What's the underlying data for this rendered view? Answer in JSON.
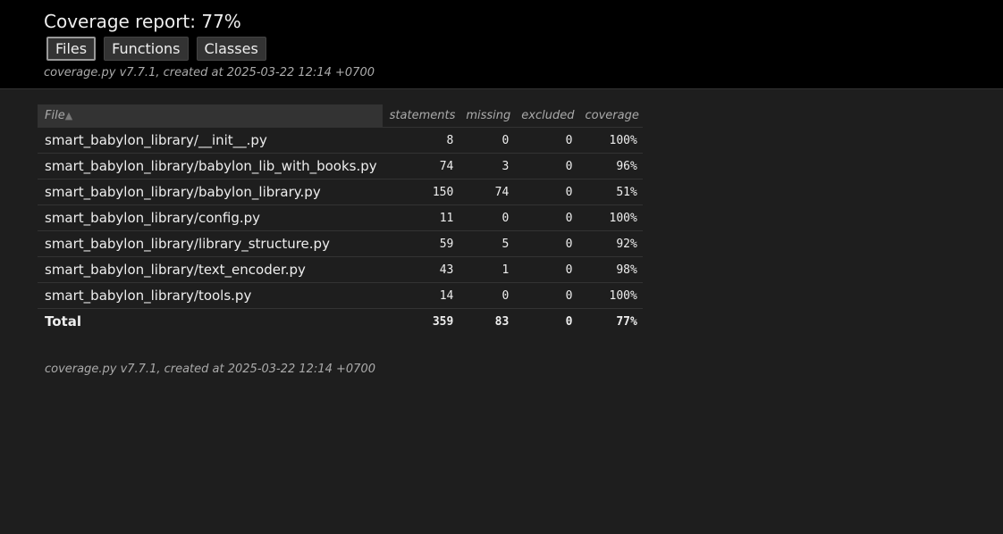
{
  "header": {
    "title": "Coverage report: 77%",
    "tabs": [
      {
        "label": "Files",
        "current": true
      },
      {
        "label": "Functions",
        "current": false
      },
      {
        "label": "Classes",
        "current": false
      }
    ],
    "meta": "coverage.py v7.7.1, created at 2025-03-22 12:14 +0700"
  },
  "table": {
    "columns": {
      "file": "File",
      "sort_indicator": "▲",
      "statements": "statements",
      "missing": "missing",
      "excluded": "excluded",
      "coverage": "coverage"
    },
    "rows": [
      {
        "file": "smart_babylon_library/__init__.py",
        "statements": "8",
        "missing": "0",
        "excluded": "0",
        "coverage": "100%"
      },
      {
        "file": "smart_babylon_library/babylon_lib_with_books.py",
        "statements": "74",
        "missing": "3",
        "excluded": "0",
        "coverage": "96%"
      },
      {
        "file": "smart_babylon_library/babylon_library.py",
        "statements": "150",
        "missing": "74",
        "excluded": "0",
        "coverage": "51%"
      },
      {
        "file": "smart_babylon_library/config.py",
        "statements": "11",
        "missing": "0",
        "excluded": "0",
        "coverage": "100%"
      },
      {
        "file": "smart_babylon_library/library_structure.py",
        "statements": "59",
        "missing": "5",
        "excluded": "0",
        "coverage": "92%"
      },
      {
        "file": "smart_babylon_library/text_encoder.py",
        "statements": "43",
        "missing": "1",
        "excluded": "0",
        "coverage": "98%"
      },
      {
        "file": "smart_babylon_library/tools.py",
        "statements": "14",
        "missing": "0",
        "excluded": "0",
        "coverage": "100%"
      }
    ],
    "total": {
      "label": "Total",
      "statements": "359",
      "missing": "83",
      "excluded": "0",
      "coverage": "77%"
    }
  },
  "footer": {
    "meta": "coverage.py v7.7.1, created at 2025-03-22 12:14 +0700"
  },
  "colors": {
    "header_bg": "#000000",
    "page_bg": "#1e1e1e",
    "text": "#eeeeee",
    "muted": "#aaaaaa",
    "header_cell_bg": "#333333"
  }
}
